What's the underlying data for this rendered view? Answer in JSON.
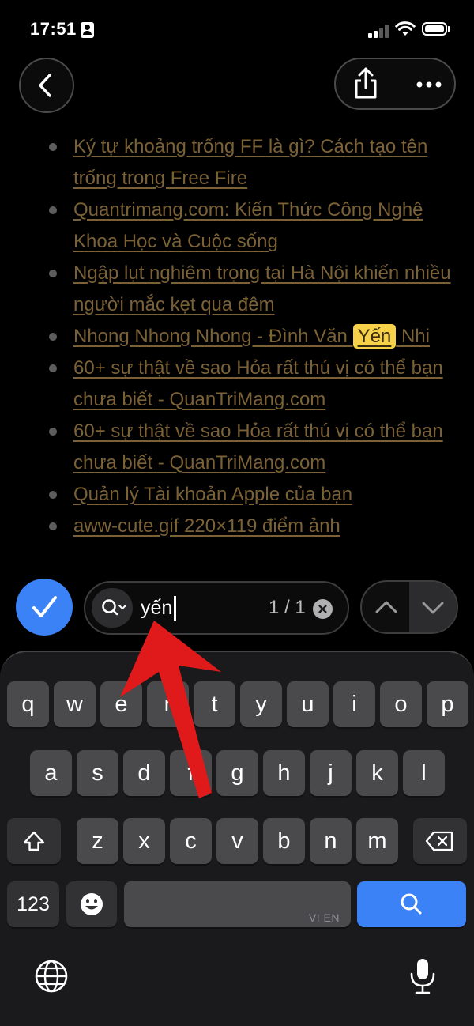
{
  "status_bar": {
    "time": "17:51"
  },
  "content_links": [
    "Ký tự khoảng trống FF là gì? Cách tạo tên trống trong Free Fire",
    "Quantrimang.com: Kiến Thức Công Nghệ Khoa Học và Cuộc sống",
    "Ngập lụt nghiêm trọng tại Hà Nội khiến nhiều người mắc kẹt qua đêm",
    {
      "before": "Nhong Nhong Nhong - Đình Văn ",
      "match": "Yến",
      "after": " Nhi"
    },
    "60+ sự thật về sao Hỏa rất thú vị có thể bạn chưa biết - QuanTriMang.com",
    "60+ sự thật về sao Hỏa rất thú vị có thể bạn chưa biết - QuanTriMang.com",
    "Quản lý Tài khoản Apple của bạn",
    "aww-cute.gif 220×119 điểm ảnh"
  ],
  "find_bar": {
    "query": "yến",
    "match_count": "1 / 1"
  },
  "keyboard": {
    "row1": [
      "q",
      "w",
      "e",
      "r",
      "t",
      "y",
      "u",
      "i",
      "o",
      "p"
    ],
    "row2": [
      "a",
      "s",
      "d",
      "f",
      "g",
      "h",
      "j",
      "k",
      "l"
    ],
    "row3": [
      "z",
      "x",
      "c",
      "v",
      "b",
      "n",
      "m"
    ],
    "numbers_label": "123",
    "space_hint": "VI EN"
  },
  "colors": {
    "accent": "#3b82f6",
    "link": "#7a6136",
    "highlight": "#f7d147",
    "arrow": "#e01a1a"
  },
  "icons": {
    "back": "chevron-left-icon",
    "share": "share-icon",
    "more": "ellipsis-icon",
    "done": "checkmark-icon",
    "search_menu": "search-options-icon",
    "clear": "clear-icon",
    "prev": "chevron-up-icon",
    "next": "chevron-down-icon",
    "shift": "shift-icon",
    "delete": "delete-icon",
    "emoji": "emoji-icon",
    "search_key": "search-icon",
    "globe": "globe-icon",
    "mic": "microphone-icon"
  }
}
